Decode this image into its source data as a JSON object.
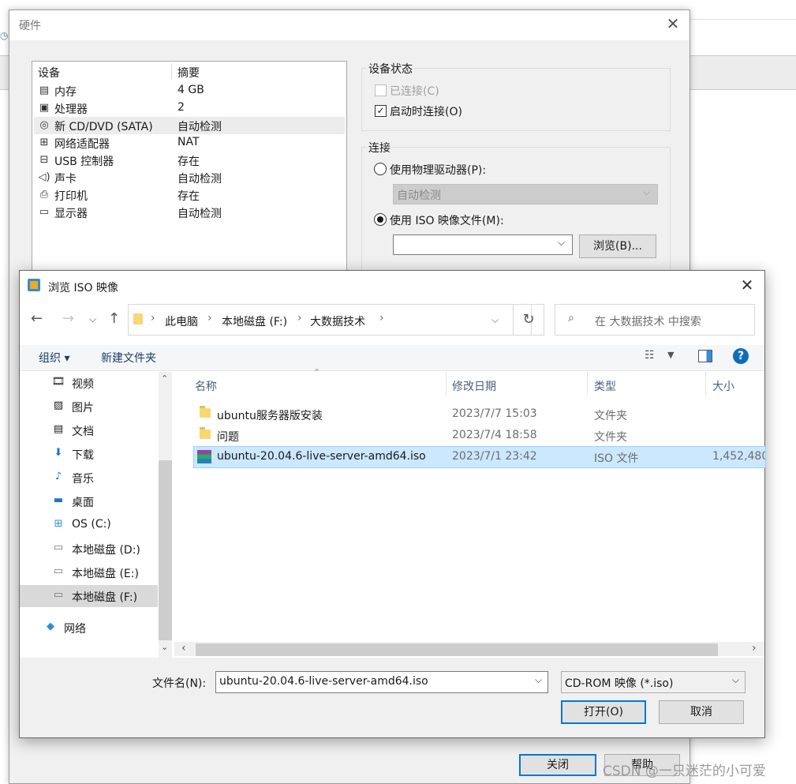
{
  "hardware_dialog": {
    "title": "硬件",
    "list_headers": {
      "device": "设备",
      "summary": "摘要"
    },
    "devices": [
      {
        "icon": "memory-icon",
        "name": "内存",
        "summary": "4 GB"
      },
      {
        "icon": "processor-icon",
        "name": "处理器",
        "summary": "2"
      },
      {
        "icon": "cd-dvd-icon",
        "name": "新 CD/DVD (SATA)",
        "summary": "自动检测",
        "selected": true
      },
      {
        "icon": "network-adapter-icon",
        "name": "网络适配器",
        "summary": "NAT"
      },
      {
        "icon": "usb-icon",
        "name": "USB 控制器",
        "summary": "存在"
      },
      {
        "icon": "sound-card-icon",
        "name": "声卡",
        "summary": "自动检测"
      },
      {
        "icon": "printer-icon",
        "name": "打印机",
        "summary": "存在"
      },
      {
        "icon": "display-icon",
        "name": "显示器",
        "summary": "自动检测"
      }
    ],
    "device_status": {
      "label": "设备状态",
      "connected": {
        "label": "已连接(C)",
        "checked": false,
        "enabled": false
      },
      "connect_at_power_on": {
        "label": "启动时连接(O)",
        "checked": true
      }
    },
    "connection": {
      "label": "连接",
      "physical_drive": {
        "label": "使用物理驱动器(P):",
        "selected": false,
        "dropdown_value": "自动检测"
      },
      "iso_image": {
        "label": "使用 ISO 映像文件(M):",
        "selected": true,
        "path_value": ""
      },
      "browse_button": "浏览(B)..."
    },
    "close_button": "关闭",
    "help_button": "帮助"
  },
  "browse_dialog": {
    "title": "浏览 ISO 映像",
    "breadcrumb": [
      "此电脑",
      "本地磁盘 (F:)",
      "大数据技术"
    ],
    "search_placeholder": "在 大数据技术 中搜索",
    "toolbar": {
      "organize": "组织 ▾",
      "new_folder": "新建文件夹"
    },
    "nav_items": [
      {
        "icon": "video-icon",
        "label": "视频"
      },
      {
        "icon": "pictures-icon",
        "label": "图片"
      },
      {
        "icon": "documents-icon",
        "label": "文档"
      },
      {
        "icon": "downloads-icon",
        "label": "下载"
      },
      {
        "icon": "music-icon",
        "label": "音乐"
      },
      {
        "icon": "desktop-icon",
        "label": "桌面"
      },
      {
        "icon": "windows-drive-icon",
        "label": "OS (C:)"
      },
      {
        "icon": "drive-icon",
        "label": "本地磁盘 (D:)"
      },
      {
        "icon": "drive-icon",
        "label": "本地磁盘 (E:)"
      },
      {
        "icon": "drive-icon",
        "label": "本地磁盘 (F:)",
        "selected": true
      },
      {
        "icon": "network-icon",
        "label": "网络"
      }
    ],
    "columns": {
      "name": "名称",
      "modified": "修改日期",
      "type": "类型",
      "size": "大小"
    },
    "files": [
      {
        "icon": "folder-icon",
        "name": "ubuntu服务器版安装",
        "modified": "2023/7/7 15:03",
        "type": "文件夹",
        "size": ""
      },
      {
        "icon": "folder-icon",
        "name": "问题",
        "modified": "2023/7/4 18:58",
        "type": "文件夹",
        "size": ""
      },
      {
        "icon": "iso-archive-icon",
        "name": "ubuntu-20.04.6-live-server-amd64.iso",
        "modified": "2023/7/1 23:42",
        "type": "ISO 文件",
        "size": "1,452,480",
        "selected": true
      }
    ],
    "filename_label": "文件名(N):",
    "filename_value": "ubuntu-20.04.6-live-server-amd64.iso",
    "filetype_value": "CD-ROM 映像 (*.iso)",
    "open_button": "打开(O)",
    "cancel_button": "取消"
  },
  "watermark": "CSDN @一只迷茫的小可爱"
}
